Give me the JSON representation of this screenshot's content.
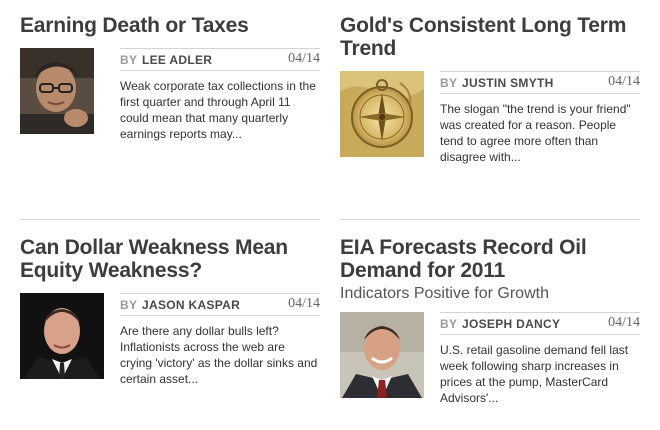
{
  "articles": [
    {
      "title": "Earning Death or Taxes",
      "subtitle": "",
      "by": "BY",
      "author": "LEE ADLER",
      "date": "04/14",
      "excerpt": "Weak corporate tax collections in the first quarter and through April 11 could mean that many quarterly earnings reports may..."
    },
    {
      "title": "Gold's Consistent Long Term Trend",
      "subtitle": "",
      "by": "BY",
      "author": "JUSTIN SMYTH",
      "date": "04/14",
      "excerpt": "The slogan \"the trend is your friend\" was created for a reason. People tend to agree more often than disagree with..."
    },
    {
      "title": "Can Dollar Weakness Mean Equity Weakness?",
      "subtitle": "",
      "by": "BY",
      "author": "JASON KASPAR",
      "date": "04/14",
      "excerpt": "Are there any dollar bulls left? Inflationists across the web are crying 'victory' as the dollar sinks and certain asset..."
    },
    {
      "title": "EIA Forecasts Record Oil Demand for 2011",
      "subtitle": "Indicators Positive for Growth",
      "by": "BY",
      "author": "JOSEPH DANCY",
      "date": "04/14",
      "excerpt": "U.S. retail gasoline demand fell last week following sharp increases in prices at the pump, MasterCard Advisors'..."
    }
  ]
}
